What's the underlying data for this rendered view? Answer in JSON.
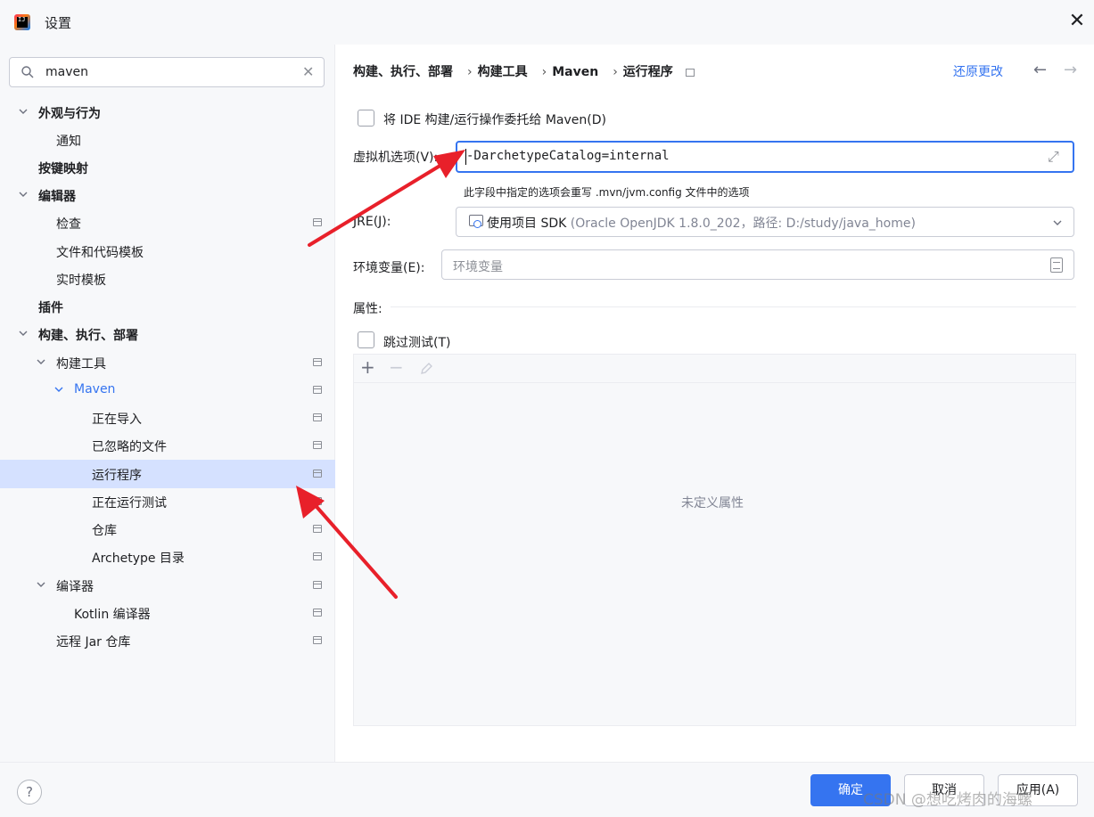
{
  "window": {
    "title": "设置"
  },
  "search": {
    "value": "maven"
  },
  "tree": [
    {
      "label": "外观与行为",
      "bold": true
    },
    {
      "label": "通知"
    },
    {
      "label": "按键映射",
      "bold": true
    },
    {
      "label": "编辑器",
      "bold": true
    },
    {
      "label": "检查"
    },
    {
      "label": "文件和代码模板"
    },
    {
      "label": "实时模板"
    },
    {
      "label": "插件",
      "bold": true
    },
    {
      "label": "构建、执行、部署",
      "bold": true
    },
    {
      "label": "构建工具"
    },
    {
      "label": "Maven"
    },
    {
      "label": "正在导入"
    },
    {
      "label": "已忽略的文件"
    },
    {
      "label": "运行程序",
      "selected": true
    },
    {
      "label": "正在运行测试"
    },
    {
      "label": "仓库"
    },
    {
      "label": "Archetype 目录"
    },
    {
      "label": "编译器"
    },
    {
      "label": "Kotlin 编译器"
    },
    {
      "label": "远程 Jar 仓库"
    }
  ],
  "breadcrumb": [
    "构建、执行、部署",
    "构建工具",
    "Maven",
    "运行程序"
  ],
  "header": {
    "revert_label": "还原更改"
  },
  "form": {
    "delegate_label": "将 IDE 构建/运行操作委托给 Maven(D)",
    "vm_label": "虚拟机选项(V):",
    "vm_value": "-DarchetypeCatalog=internal",
    "vm_hint": "此字段中指定的选项会重写 .mvn/jvm.config 文件中的选项",
    "jre_label": "JRE(J):",
    "jre_value": "使用项目 SDK",
    "jre_desc": "(Oracle OpenJDK 1.8.0_202，路径: D:/study/java_home)",
    "env_label": "环境变量(E):",
    "env_placeholder": "环境变量",
    "props_label": "属性:",
    "skip_tests_label": "跳过测试(T)",
    "empty_props": "未定义属性"
  },
  "buttons": {
    "ok": "确定",
    "cancel": "取消",
    "apply": "应用(A)",
    "help": "?"
  },
  "watermark": "CSDN @想吃烤肉的海螺",
  "colors": {
    "accent": "#3574f0",
    "selection": "#d5e1ff",
    "arrow": "#e8202a"
  }
}
